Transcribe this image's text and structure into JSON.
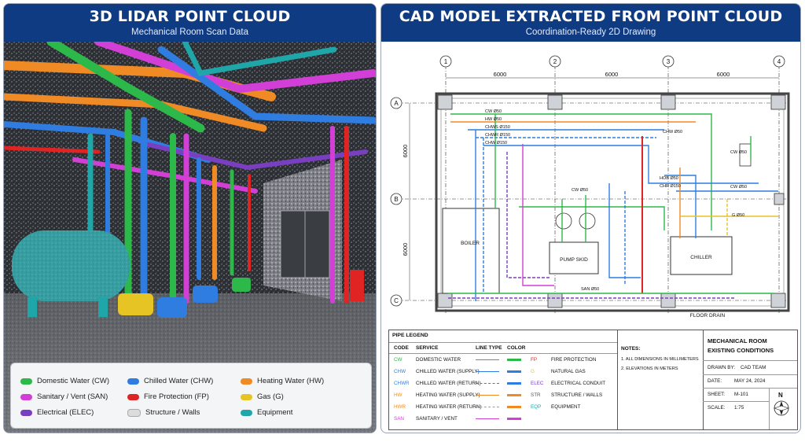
{
  "left_panel": {
    "title": "3D LIDAR POINT CLOUD",
    "subtitle": "Mechanical Room Scan Data",
    "legend": [
      {
        "label": "Domestic Water (CW)",
        "color": "#2db84a"
      },
      {
        "label": "Chilled Water (CHW)",
        "color": "#2f7de1"
      },
      {
        "label": "Heating Water (HW)",
        "color": "#f08a24"
      },
      {
        "label": "Sanitary / Vent (SAN)",
        "color": "#d23fd6"
      },
      {
        "label": "Fire Protection (FP)",
        "color": "#e02424"
      },
      {
        "label": "Gas (G)",
        "color": "#e6c424"
      },
      {
        "label": "Electrical (ELEC)",
        "color": "#7a3fc0"
      },
      {
        "label": "Structure / Walls",
        "color": "#dcdcdc"
      },
      {
        "label": "Equipment",
        "color": "#1fa6a8"
      }
    ]
  },
  "right_panel": {
    "title": "CAD MODEL EXTRACTED FROM POINT CLOUD",
    "subtitle": "Coordination-Ready 2D Drawing",
    "grid": {
      "columns": [
        "1",
        "2",
        "3",
        "4"
      ],
      "rows": [
        "A",
        "B",
        "C"
      ],
      "col_dims": [
        "6000",
        "6000",
        "6000"
      ],
      "row_dims": [
        "6000",
        "6000"
      ]
    },
    "plan_labels": {
      "boiler": "BOILER",
      "pump_skid": "PUMP SKID",
      "chiller": "CHILLER",
      "floor_drain": "FLOOR DRAIN",
      "cw1": "CW Ø50",
      "hw1": "HW Ø50",
      "chws": "CHWS Ø150",
      "chwr": "CHWR Ø150",
      "chw1": "CHW Ø150",
      "chw_mid": "CHW Ø50",
      "cw_mid": "CW Ø50",
      "hwr_mid": "HOB Ø50",
      "chr_mid": "CHR Ø150",
      "cw_right1": "CW Ø50",
      "cw_right2": "CW Ø50",
      "g_mid": "G Ø50",
      "san_low": "SAN Ø50"
    },
    "pipe_legend": {
      "title": "PIPE LEGEND",
      "headers": [
        "CODE",
        "SERVICE",
        "LINE TYPE",
        "COLOR"
      ],
      "rows_left": [
        {
          "code": "CW",
          "service": "DOMESTIC WATER",
          "color": "#2db84a",
          "dash": false
        },
        {
          "code": "CHW",
          "service": "CHILLED WATER (SUPPLY)",
          "color": "#2f7de1",
          "dash": false
        },
        {
          "code": "CHWR",
          "service": "CHILLED WATER (RETURN)",
          "color": "#2f7de1",
          "dash": true
        },
        {
          "code": "HW",
          "service": "HEATING WATER (SUPPLY)",
          "color": "#f08a24",
          "dash": false
        },
        {
          "code": "HWR",
          "service": "HEATING WATER (RETURN)",
          "color": "#f08a24",
          "dash": true
        },
        {
          "code": "SAN",
          "service": "SANITARY / VENT",
          "color": "#d23fd6",
          "dash": false
        }
      ],
      "rows_right": [
        {
          "code": "FP",
          "service": "FIRE PROTECTION",
          "color": "#e02424",
          "dash": false
        },
        {
          "code": "G",
          "service": "NATURAL GAS",
          "color": "#e6c424",
          "dash": false
        },
        {
          "code": "ELEC",
          "service": "ELECTRICAL CONDUIT",
          "color": "#7a3fc0",
          "dash": true
        },
        {
          "code": "STR",
          "service": "STRUCTURE / WALLS",
          "color": "#555555",
          "dash": false
        },
        {
          "code": "EQP",
          "service": "EQUIPMENT",
          "color": "#1fa6a8",
          "dash": true
        }
      ]
    },
    "notes": {
      "title": "NOTES:",
      "items": [
        "1.  ALL DIMENSIONS IN MILLIMETERS",
        "2.  ELEVATIONS IN METERS"
      ]
    },
    "title_block": {
      "title_line1": "MECHANICAL ROOM",
      "title_line2": "EXISTING CONDITIONS",
      "drawn_by_label": "DRAWN BY:",
      "drawn_by": "CAD TEAM",
      "date_label": "DATE:",
      "date": "MAY 24, 2024",
      "sheet_label": "SHEET:",
      "sheet": "M-101",
      "scale_label": "SCALE:",
      "scale": "1:75",
      "north": "N"
    }
  }
}
